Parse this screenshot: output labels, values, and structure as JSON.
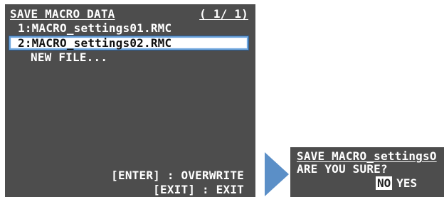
{
  "main_panel": {
    "title": "SAVE MACRO DATA",
    "page_indicator": "( 1/ 1)",
    "items": [
      "1:MACRO_settings01.RMC",
      "2:MACRO_settings02.RMC",
      "NEW FILE..."
    ],
    "selected_index": 1,
    "key_hints": [
      "[ENTER] : OVERWRITE",
      "[EXIT] : EXIT"
    ]
  },
  "confirm_dialog": {
    "title": "SAVE MACRO_settingsO",
    "prompt": "ARE YOU SURE?",
    "no_label": "NO",
    "yes_label": "YES",
    "focused_button": "NO"
  },
  "colors": {
    "osd_background": "#4d4d4d",
    "text": "#ffffff",
    "selection_border": "#6fa6dc",
    "arrow": "#5b8fc7"
  },
  "icons": {
    "transition": "right-triangle-arrow-icon"
  }
}
